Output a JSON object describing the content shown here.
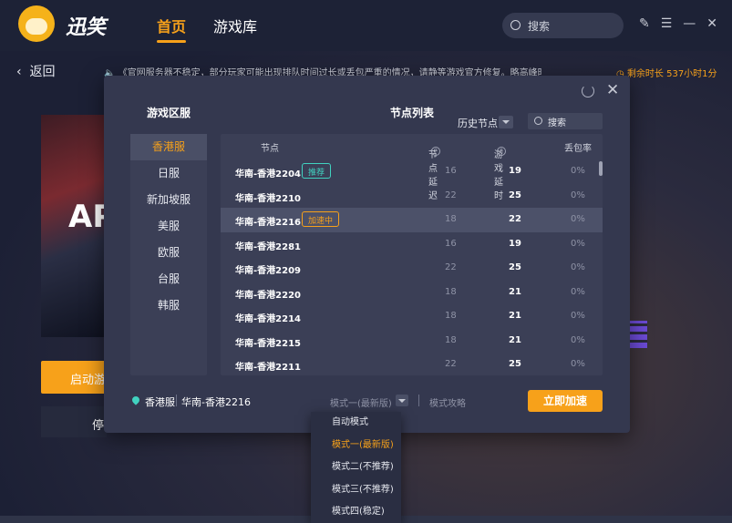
{
  "app": {
    "logo_text": "迅笑",
    "nav_home": "首页",
    "nav_library": "游戏库",
    "search_placeholder": "搜索",
    "back_label": "返回",
    "notice": "《官网服务器不稳定，部分玩家可能出现排队时间过长或丢包严重的情况，请静等游戏官方修复。略高峰时",
    "remaining": "剩余时长 537小时1分",
    "cover_text": "AP",
    "start_button": "启动游",
    "stop_button": "停"
  },
  "modal": {
    "region_title": "游戏区服",
    "node_title": "节点列表",
    "history_label": "历史节点",
    "search_placeholder": "搜索",
    "regions": [
      {
        "label": "香港服",
        "active": true
      },
      {
        "label": "日服",
        "active": false
      },
      {
        "label": "新加坡服",
        "active": false
      },
      {
        "label": "美服",
        "active": false
      },
      {
        "label": "欧服",
        "active": false
      },
      {
        "label": "台服",
        "active": false
      },
      {
        "label": "韩服",
        "active": false
      }
    ],
    "columns": {
      "node": "节点",
      "node_delay": "节点延迟",
      "game_delay": "游戏延时",
      "loss": "丢包率"
    },
    "nodes": [
      {
        "name": "华南-香港2204",
        "badge": "推荐",
        "node_delay": "16",
        "game_delay": "19",
        "loss": "0%"
      },
      {
        "name": "华南-香港2210",
        "badge": "",
        "node_delay": "22",
        "game_delay": "25",
        "loss": "0%"
      },
      {
        "name": "华南-香港2216",
        "badge": "加速中",
        "node_delay": "18",
        "game_delay": "22",
        "loss": "0%"
      },
      {
        "name": "华南-香港2281",
        "badge": "",
        "node_delay": "16",
        "game_delay": "19",
        "loss": "0%"
      },
      {
        "name": "华南-香港2209",
        "badge": "",
        "node_delay": "22",
        "game_delay": "25",
        "loss": "0%"
      },
      {
        "name": "华南-香港2220",
        "badge": "",
        "node_delay": "18",
        "game_delay": "21",
        "loss": "0%"
      },
      {
        "name": "华南-香港2214",
        "badge": "",
        "node_delay": "18",
        "game_delay": "21",
        "loss": "0%"
      },
      {
        "name": "华南-香港2215",
        "badge": "",
        "node_delay": "18",
        "game_delay": "21",
        "loss": "0%"
      },
      {
        "name": "华南-香港2211",
        "badge": "",
        "node_delay": "22",
        "game_delay": "25",
        "loss": "0%"
      }
    ],
    "selected_region": "香港服",
    "selected_node": "华南-香港2216",
    "mode_label": "模式一(最新版)",
    "mode_guide": "模式攻略",
    "accelerate_button": "立即加速"
  },
  "dropdown": {
    "items": [
      {
        "label": "自动模式",
        "active": false
      },
      {
        "label": "模式一(最新版)",
        "active": true
      },
      {
        "label": "模式二(不推荐)",
        "active": false
      },
      {
        "label": "模式三(不推荐)",
        "active": false
      },
      {
        "label": "模式四(稳定)",
        "active": false
      }
    ]
  }
}
